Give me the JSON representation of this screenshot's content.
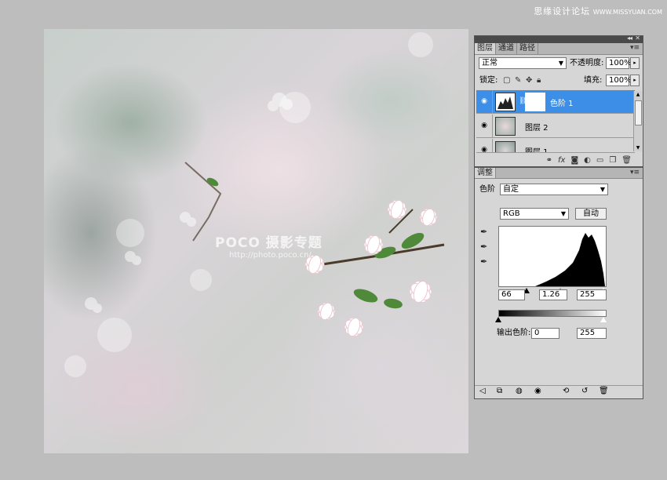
{
  "watermark": {
    "cn": "思缘设计论坛",
    "en": "WWW.MISSYUAN.COM"
  },
  "photo_watermark": {
    "brand": "POCO 摄影专题",
    "url": "http://photo.poco.cn/"
  },
  "layers_panel": {
    "tabs": [
      "图层",
      "通道",
      "路径"
    ],
    "blend_mode": "正常",
    "opacity_label": "不透明度:",
    "opacity_value": "100%",
    "lock_label": "锁定:",
    "fill_label": "填充:",
    "fill_value": "100%",
    "layers": [
      {
        "name": "色阶 1",
        "selected": true
      },
      {
        "name": "图层 2",
        "selected": false
      },
      {
        "name": "图层 1",
        "selected": false
      }
    ],
    "footer_icons": [
      "link-icon",
      "fx-icon",
      "mask-icon",
      "adjustment-icon",
      "group-icon",
      "new-layer-icon",
      "trash-icon"
    ]
  },
  "adjust_panel": {
    "tab": "调整",
    "type_label": "色阶",
    "preset": "自定",
    "channel": "RGB",
    "auto_button": "自动",
    "input_black": "66",
    "input_gamma": "1.26",
    "input_white": "255",
    "output_label": "输出色阶:",
    "output_black": "0",
    "output_white": "255",
    "footer_icons": [
      "back-icon",
      "expand-icon",
      "clip-icon",
      "visibility-icon",
      "view-previous-icon",
      "reset-icon",
      "trash-icon"
    ]
  }
}
